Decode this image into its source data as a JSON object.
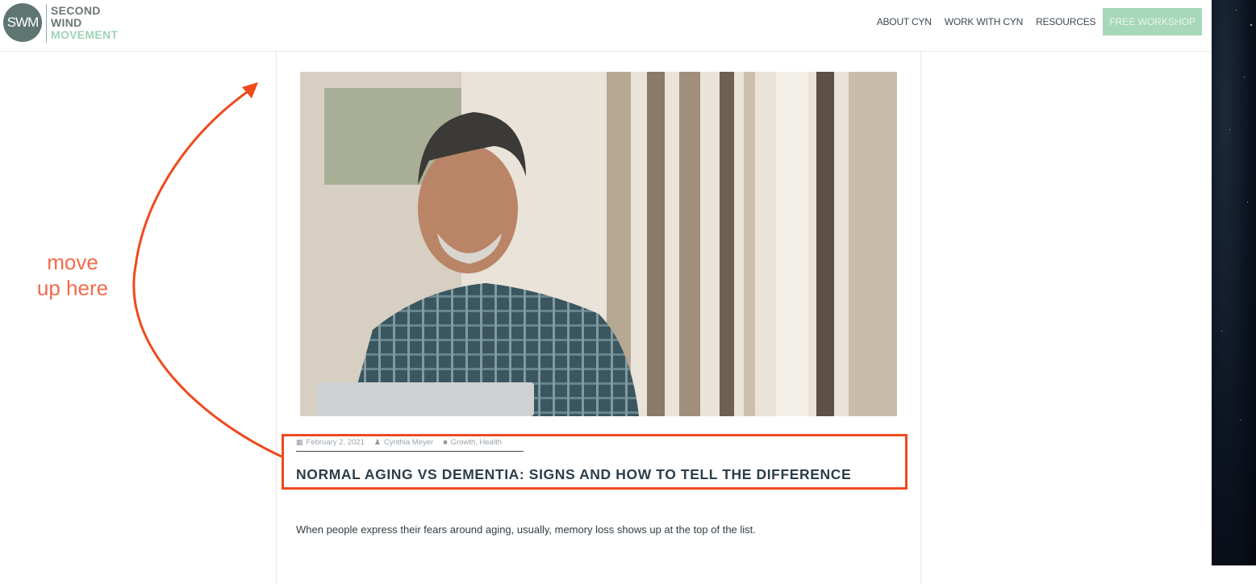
{
  "header": {
    "logo": {
      "monogram": "SWM",
      "line1": "SECOND",
      "line2": "WIND",
      "line3": "MOVEMENT"
    },
    "nav": [
      {
        "label": "ABOUT CYN"
      },
      {
        "label": "WORK WITH CYN"
      },
      {
        "label": "RESOURCES"
      }
    ],
    "cta_label": "FREE WORKSHOP"
  },
  "post": {
    "meta": {
      "date": "February 2, 2021",
      "date_icon": "calendar-icon",
      "author": "Cynthia Meyer",
      "author_icon": "user-icon",
      "categories": "Growth, Health",
      "categories_icon": "folder-icon"
    },
    "title": "NORMAL AGING VS DEMENTIA: SIGNS AND HOW TO TELL THE DIFFERENCE",
    "intro": "When people express their fears around aging, usually, memory loss shows up at the top of the list."
  },
  "annotation": {
    "line1": "move",
    "line2": "up here",
    "color": "#f26a4b",
    "box_color": "#ee4a1e"
  },
  "colors": {
    "brand_dark": "#5f7572",
    "brand_green": "#9ed3b3",
    "cta_bg": "#a7d8b9",
    "title": "#2c3e4a"
  }
}
